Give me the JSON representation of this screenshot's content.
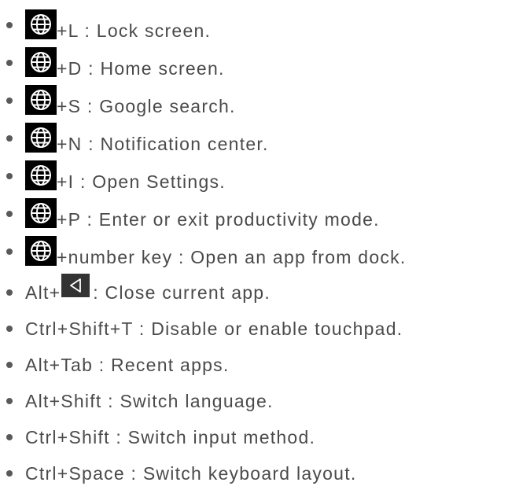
{
  "shortcuts": [
    {
      "icon": "globe-key-icon",
      "text": "+L : Lock screen."
    },
    {
      "icon": "globe-key-icon",
      "text": "+D : Home screen."
    },
    {
      "icon": "globe-key-icon",
      "text": "+S : Google search."
    },
    {
      "icon": "globe-key-icon",
      "text": "+N : Notification center."
    },
    {
      "icon": "globe-key-icon",
      "text": "+I : Open Settings."
    },
    {
      "icon": "globe-key-icon",
      "text": "+P : Enter or exit productivity mode."
    },
    {
      "icon": "globe-key-icon",
      "text": "+number key : Open an app from dock."
    },
    {
      "prefix": "Alt+",
      "icon": "back-key-icon",
      "text": " : Close current app."
    },
    {
      "text": "Ctrl+Shift+T : Disable or enable touchpad."
    },
    {
      "text": "Alt+Tab : Recent apps."
    },
    {
      "text": "Alt+Shift : Switch language."
    },
    {
      "text": "Ctrl+Shift : Switch input method."
    },
    {
      "text": "Ctrl+Space : Switch keyboard layout."
    }
  ],
  "colors": {
    "text": "#4a4a4a",
    "bullet": "#595959",
    "key_background": "#000000",
    "key_glyph": "#ffffff",
    "back_key_background": "#333333"
  }
}
